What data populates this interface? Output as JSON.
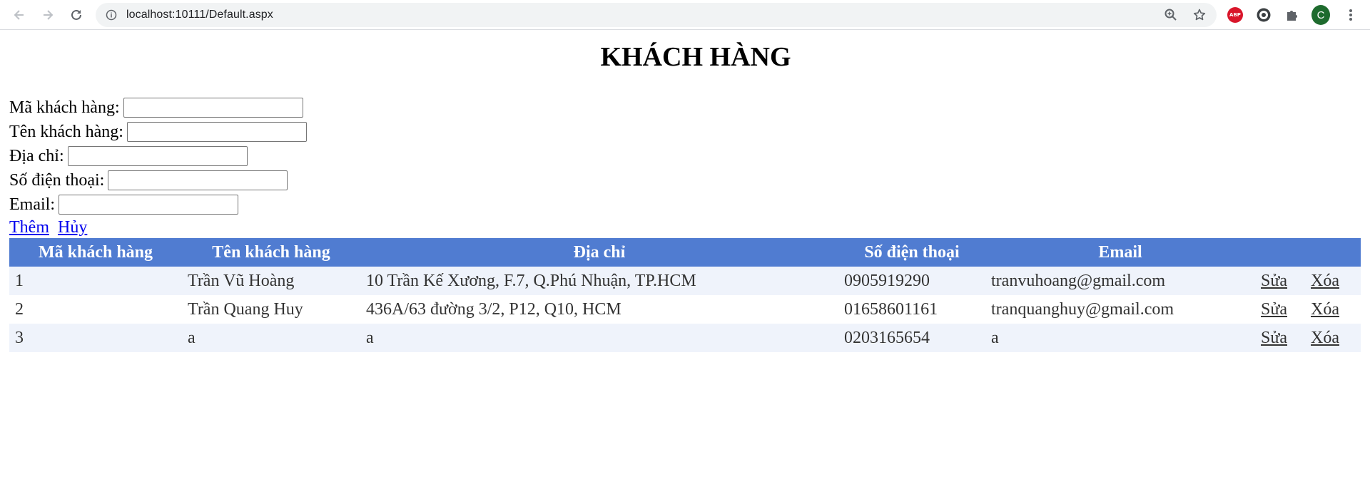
{
  "browser": {
    "url": "localhost:10111/Default.aspx",
    "profile_initial": "C",
    "abp_label": "ABP"
  },
  "page": {
    "title": "KHÁCH HÀNG"
  },
  "form": {
    "fields": [
      {
        "label": "Mã khách hàng:",
        "value": ""
      },
      {
        "label": "Tên khách hàng:",
        "value": ""
      },
      {
        "label": "Địa chỉ:",
        "value": ""
      },
      {
        "label": "Số điện thoại:",
        "value": ""
      },
      {
        "label": "Email:",
        "value": ""
      }
    ],
    "add_label": "Thêm",
    "cancel_label": "Hủy"
  },
  "table": {
    "headers": [
      "Mã khách hàng",
      "Tên khách hàng",
      "Địa chỉ",
      "Số điện thoại",
      "Email"
    ],
    "edit_label": "Sửa",
    "delete_label": "Xóa",
    "rows": [
      {
        "id": "1",
        "name": "Trần Vũ Hoàng",
        "address": "10 Trần Kế Xương, F.7, Q.Phú Nhuận, TP.HCM",
        "phone": "0905919290",
        "email": "tranvuhoang@gmail.com"
      },
      {
        "id": "2",
        "name": "Trần Quang Huy",
        "address": "436A/63 đường 3/2, P12, Q10, HCM",
        "phone": "01658601161",
        "email": "tranquanghuy@gmail.com"
      },
      {
        "id": "3",
        "name": "a",
        "address": "a",
        "phone": "0203165654",
        "email": "a"
      }
    ]
  },
  "colors": {
    "header_bg": "#507cd1",
    "row_alt_bg": "#eff3fb",
    "link": "#0000ee"
  },
  "icons": [
    "back-icon",
    "forward-icon",
    "reload-icon",
    "site-info-icon",
    "zoom-icon",
    "bookmark-star-icon",
    "adblock-plus-icon",
    "extension-icon",
    "puzzle-icon",
    "menu-dots-icon"
  ]
}
